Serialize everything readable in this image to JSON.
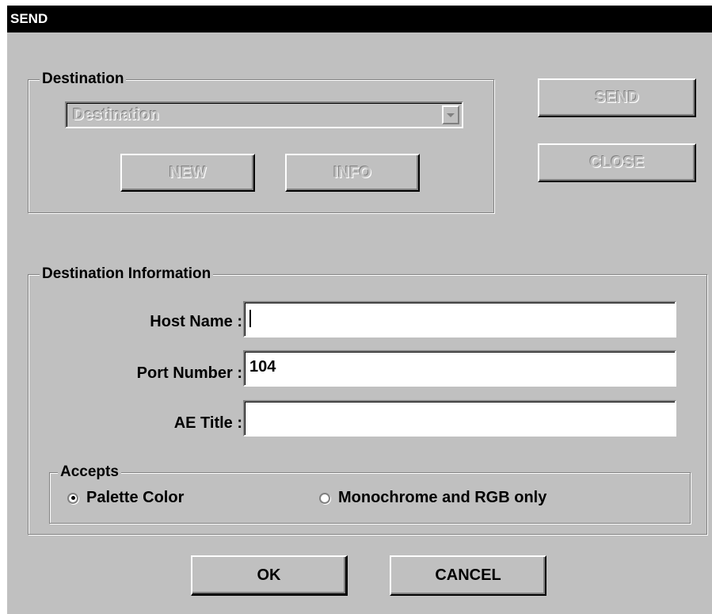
{
  "window": {
    "title": "SEND"
  },
  "destination_group": {
    "legend": "Destination",
    "combo_value": "Destination",
    "new_label": "NEW",
    "info_label": "INFO"
  },
  "actions": {
    "send_label": "SEND",
    "close_label": "CLOSE"
  },
  "info_group": {
    "legend": "Destination Information",
    "host_label": "Host Name :",
    "host_value": "",
    "port_label": "Port Number :",
    "port_value": "104",
    "ae_label": "AE Title :",
    "ae_value": ""
  },
  "accepts": {
    "legend": "Accepts",
    "options": [
      {
        "label": "Palette Color",
        "selected": true
      },
      {
        "label": "Monochrome and RGB only",
        "selected": false
      }
    ]
  },
  "footer": {
    "ok_label": "OK",
    "cancel_label": "CANCEL"
  },
  "colors": {
    "face": "#c0c0c0",
    "title_bar": "#000000",
    "title_text": "#ffffff"
  }
}
